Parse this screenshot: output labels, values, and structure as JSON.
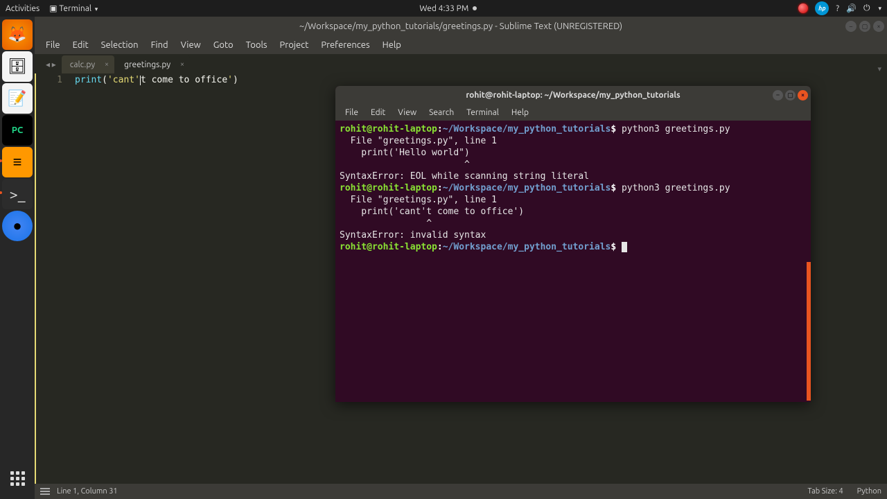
{
  "topbar": {
    "activities": "Activities",
    "app_indicator": "Terminal",
    "clock": "Wed  4:33 PM"
  },
  "launcher": {
    "items": [
      "firefox",
      "files",
      "text-editor",
      "pycharm",
      "sublime",
      "terminal",
      "chromium"
    ]
  },
  "sublime": {
    "title": "~/Workspace/my_python_tutorials/greetings.py - Sublime Text (UNREGISTERED)",
    "menu": [
      "File",
      "Edit",
      "Selection",
      "Find",
      "View",
      "Goto",
      "Tools",
      "Project",
      "Preferences",
      "Help"
    ],
    "tabs": [
      {
        "label": "calc.py",
        "active": false
      },
      {
        "label": "greetings.py",
        "active": true
      }
    ],
    "gutter_line": "1",
    "code": {
      "fn": "print",
      "open": "(",
      "str1": "'cant'",
      "caret_after": "t come to office",
      "str2_tail": "'",
      "close": ")"
    },
    "status_left": "Line 1, Column 31",
    "status_indent": "Tab Size: 4",
    "status_lang": "Python"
  },
  "terminal": {
    "title": "rohit@rohit-laptop: ~/Workspace/my_python_tutorials",
    "menu": [
      "File",
      "Edit",
      "View",
      "Search",
      "Terminal",
      "Help"
    ],
    "prompt_user": "rohit@rohit-laptop",
    "prompt_sep": ":",
    "prompt_path": "~/Workspace/my_python_tutorials",
    "prompt_dollar": "$",
    "cmd1": " python3 greetings.py",
    "out1_l1": "  File \"greetings.py\", line 1",
    "out1_l2": "    print('Hello world\")",
    "out1_l3": "                       ^",
    "out1_l4": "SyntaxError: EOL while scanning string literal",
    "cmd2": " python3 greetings.py",
    "out2_l1": "  File \"greetings.py\", line 1",
    "out2_l2": "    print('cant't come to office')",
    "out2_l3": "                ^",
    "out2_l4": "SyntaxError: invalid syntax"
  }
}
